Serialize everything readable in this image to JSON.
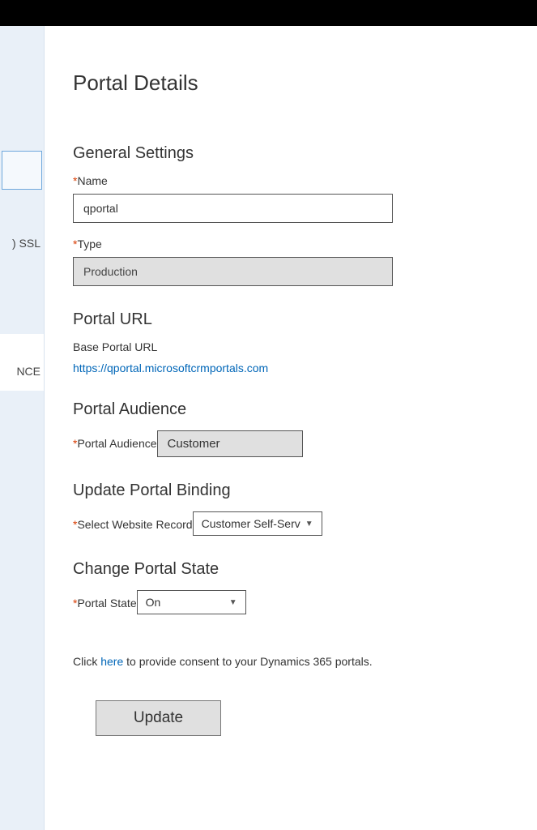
{
  "sidebar": {
    "ssl_fragment": ") SSL",
    "nce_fragment": "NCE"
  },
  "page": {
    "title": "Portal Details"
  },
  "general": {
    "heading": "General Settings",
    "name_label": "Name",
    "name_value": "qportal",
    "type_label": "Type",
    "type_value": "Production"
  },
  "portal_url": {
    "heading": "Portal URL",
    "sub_label": "Base Portal URL",
    "link": "https://qportal.microsoftcrmportals.com"
  },
  "audience": {
    "heading": "Portal Audience",
    "label": "Portal Audience",
    "value": "Customer"
  },
  "binding": {
    "heading": "Update Portal Binding",
    "label": "Select Website Record",
    "value": "Customer Self-Serv"
  },
  "state": {
    "heading": "Change Portal State",
    "label": "Portal State",
    "value": "On"
  },
  "consent": {
    "pre": "Click ",
    "link": "here",
    "post": " to provide consent to your Dynamics 365 portals."
  },
  "buttons": {
    "update": "Update"
  }
}
